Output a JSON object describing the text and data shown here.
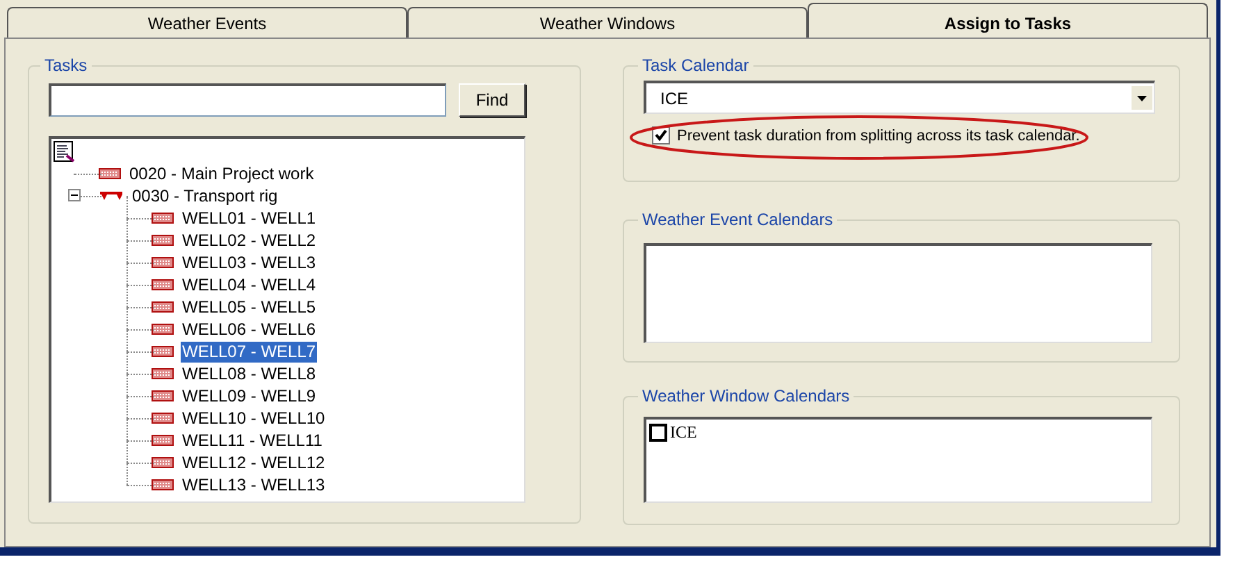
{
  "tabs": [
    {
      "label": "Weather Events",
      "selected": false
    },
    {
      "label": "Weather Windows",
      "selected": false
    },
    {
      "label": "Assign to Tasks",
      "selected": true
    }
  ],
  "tasks": {
    "title": "Tasks",
    "find_button": "Find",
    "tree": [
      {
        "label": "0020 - Main Project work",
        "selected": false
      },
      {
        "label": "0030 - Transport rig",
        "selected": false,
        "expanded": true,
        "children": [
          {
            "label": "WELL01 - WELL1",
            "selected": false
          },
          {
            "label": "WELL02 - WELL2",
            "selected": false
          },
          {
            "label": "WELL03 - WELL3",
            "selected": false
          },
          {
            "label": "WELL04 - WELL4",
            "selected": false
          },
          {
            "label": "WELL05 - WELL5",
            "selected": false
          },
          {
            "label": "WELL06 - WELL6",
            "selected": false
          },
          {
            "label": "WELL07 - WELL7",
            "selected": true
          },
          {
            "label": "WELL08 - WELL8",
            "selected": false
          },
          {
            "label": "WELL09 - WELL9",
            "selected": false
          },
          {
            "label": "WELL10 - WELL10",
            "selected": false
          },
          {
            "label": "WELL11 - WELL11",
            "selected": false
          },
          {
            "label": "WELL12 - WELL12",
            "selected": false
          },
          {
            "label": "WELL13 - WELL13",
            "selected": false
          }
        ]
      }
    ]
  },
  "task_calendar": {
    "title": "Task Calendar",
    "value": "ICE",
    "option": {
      "label": "Prevent task duration from splitting across its task calendar.",
      "checked": true
    }
  },
  "weather_event_calendars": {
    "title": "Weather Event Calendars"
  },
  "weather_window_calendars": {
    "title": "Weather Window Calendars",
    "items": [
      {
        "label": "ICE",
        "checked": false
      }
    ]
  }
}
